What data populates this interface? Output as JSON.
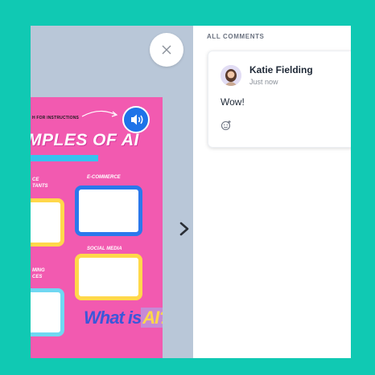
{
  "poster": {
    "hint": "H FOR INSTRUCTIONS",
    "heading": "MPLES OF AI",
    "labels": {
      "assistants": "CE\nTANTS",
      "ecommerce": "E-COMMERCE",
      "social": "SOCIAL MEDIA",
      "gaming": "MING\nCES"
    },
    "what_is": "What is",
    "ai": "AI?"
  },
  "icons": {
    "close": "close-icon",
    "next": "chevron-right-icon",
    "speaker": "speaker-icon",
    "reaction": "add-reaction-icon"
  },
  "comments": {
    "title": "ALL COMMENTS",
    "items": [
      {
        "author": "Katie Fielding",
        "time": "Just now",
        "text": "Wow!"
      }
    ]
  },
  "colors": {
    "background": "#10c9b3",
    "stage": "#b9c7d8",
    "poster": "#f25ab0",
    "accent_blue": "#1e73e8",
    "accent_yellow": "#ffd84a"
  }
}
